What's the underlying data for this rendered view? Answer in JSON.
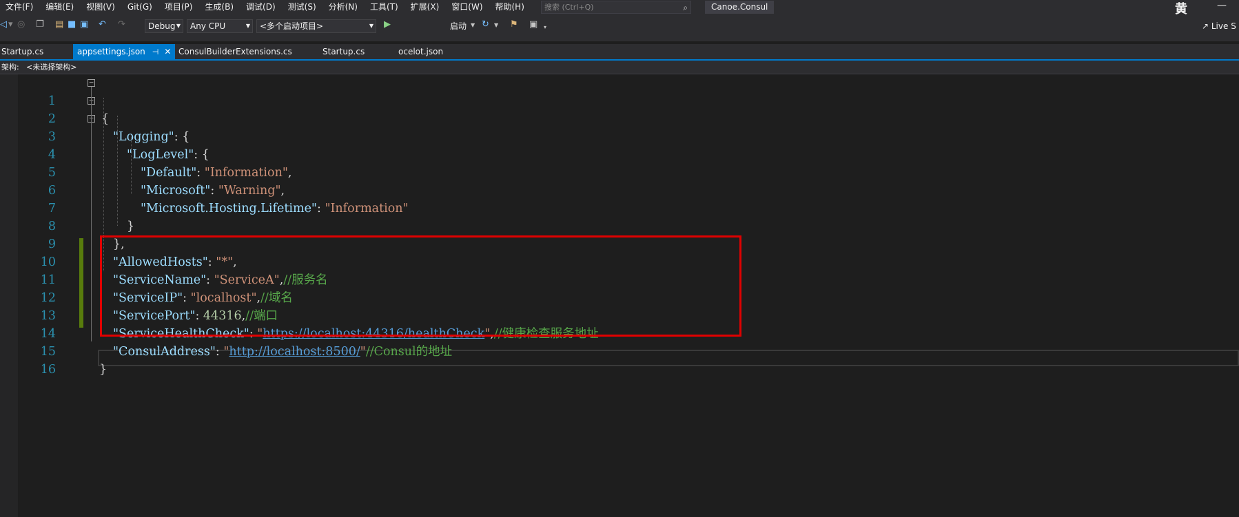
{
  "menu": [
    "文件(F)",
    "编辑(E)",
    "视图(V)",
    "Git(G)",
    "项目(P)",
    "生成(B)",
    "调试(D)",
    "测试(S)",
    "分析(N)",
    "工具(T)",
    "扩展(X)",
    "窗口(W)",
    "帮助(H)"
  ],
  "search": {
    "placeholder": "搜索 (Ctrl+Q)"
  },
  "solution_name": "Canoe.Consul",
  "user_initial": "黄",
  "minimize_glyph": "—",
  "toolbar": {
    "config": "Debug",
    "platform": "Any CPU",
    "startup": "<多个启动项目>",
    "start_label": "启动",
    "live_share": "Live S"
  },
  "tabs": [
    {
      "label": "Startup.cs",
      "active": false
    },
    {
      "label": "appsettings.json",
      "active": true
    },
    {
      "label": "ConsulBuilderExtensions.cs",
      "active": false
    },
    {
      "label": "Startup.cs",
      "active": false
    },
    {
      "label": "ocelot.json",
      "active": false
    }
  ],
  "navbar": {
    "label": "架构:",
    "value": "<未选择架构>"
  },
  "code": {
    "line_numbers": [
      "1",
      "2",
      "3",
      "4",
      "5",
      "6",
      "7",
      "8",
      "9",
      "10",
      "11",
      "12",
      "13",
      "14",
      "15",
      "16"
    ],
    "l1": {
      "p": "{"
    },
    "l2": {
      "k": "\"Logging\"",
      "p": ": {"
    },
    "l3": {
      "k": "\"LogLevel\"",
      "p": ": {"
    },
    "l4": {
      "k": "\"Default\"",
      "p1": ": ",
      "s": "\"Information\"",
      "p2": ","
    },
    "l5": {
      "k": "\"Microsoft\"",
      "p1": ": ",
      "s": "\"Warning\"",
      "p2": ","
    },
    "l6": {
      "k": "\"Microsoft.Hosting.Lifetime\"",
      "p1": ": ",
      "s": "\"Information\""
    },
    "l7": {
      "p": "}"
    },
    "l8": {
      "p": "},"
    },
    "l9": {
      "k": "\"AllowedHosts\"",
      "p1": ": ",
      "s": "\"*\"",
      "p2": ","
    },
    "l10": {
      "k": "\"ServiceName\"",
      "p1": ": ",
      "s": "\"ServiceA\"",
      "p2": ",",
      "c": "//服务名"
    },
    "l11": {
      "k": "\"ServiceIP\"",
      "p1": ": ",
      "s": "\"localhost\"",
      "p2": ",",
      "c": "//域名"
    },
    "l12": {
      "k": "\"ServicePort\"",
      "p1": ": ",
      "n": "44316",
      "p2": ",",
      "c": "//端口"
    },
    "l13": {
      "k": "\"ServiceHealthCheck\"",
      "p1": ": ",
      "q1": "\"",
      "url": "https://localhost:44316/healthCheck",
      "q2": "\"",
      "p2": ",",
      "c": "//健康检查服务地址"
    },
    "l14": {
      "k": "\"ConsulAddress\"",
      "p1": ": ",
      "q1": "\"",
      "url": "http://localhost:8500/",
      "q2": "\"",
      "c": "//Consul的地址"
    },
    "l15": {
      "p": "}"
    }
  },
  "colors": {
    "key": "#9cdcfe",
    "string": "#ce9178",
    "number": "#b5cea8",
    "comment": "#57a64a",
    "accent": "#007acc",
    "annotation_box": "#e10000",
    "change_bar": "#587c0c"
  }
}
